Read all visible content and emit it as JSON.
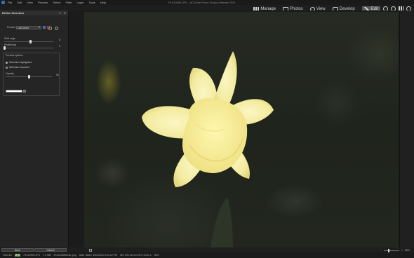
{
  "window": {
    "title": "P1020990.JPG - ACDSee Photo Studio Ultimate 2021"
  },
  "menu": [
    "File",
    "Edit",
    "View",
    "Process",
    "Select",
    "Filter",
    "Layer",
    "Tools",
    "Help"
  ],
  "modes": {
    "manage": "Manage",
    "photos": "Photos",
    "view": "View",
    "develop": "Develop",
    "edit": "Edit"
  },
  "panel": {
    "title": "Refine Selection",
    "presets_label": "Presets",
    "presets_value": "Last Used",
    "sliders": [
      {
        "label": "Shift edge",
        "value": "8",
        "fraction": 0.53
      },
      {
        "label": "Feathering",
        "value": "0",
        "fraction": 0.0
      }
    ],
    "preview": {
      "title": "Preview options",
      "options": [
        "Selection highlighted",
        "Selection exposed"
      ],
      "selected": 0,
      "opacity_label": "Opacity",
      "opacity_value": "50",
      "opacity_fraction": 0.5
    },
    "buttons": {
      "done": "Done",
      "cancel": "Cancel"
    }
  },
  "status": {
    "index": "155/160",
    "badge": "JPG",
    "filename": "P1020990.JPG",
    "filesize": "7.2 MB",
    "dimensions": "3744x2808x24b jpeg",
    "date": "Date Taken: 3/22/2021 5:04:42 PM",
    "exif": "ISO 200   46 mm   f/5.6   1/100 s",
    "zoom": "28%"
  }
}
